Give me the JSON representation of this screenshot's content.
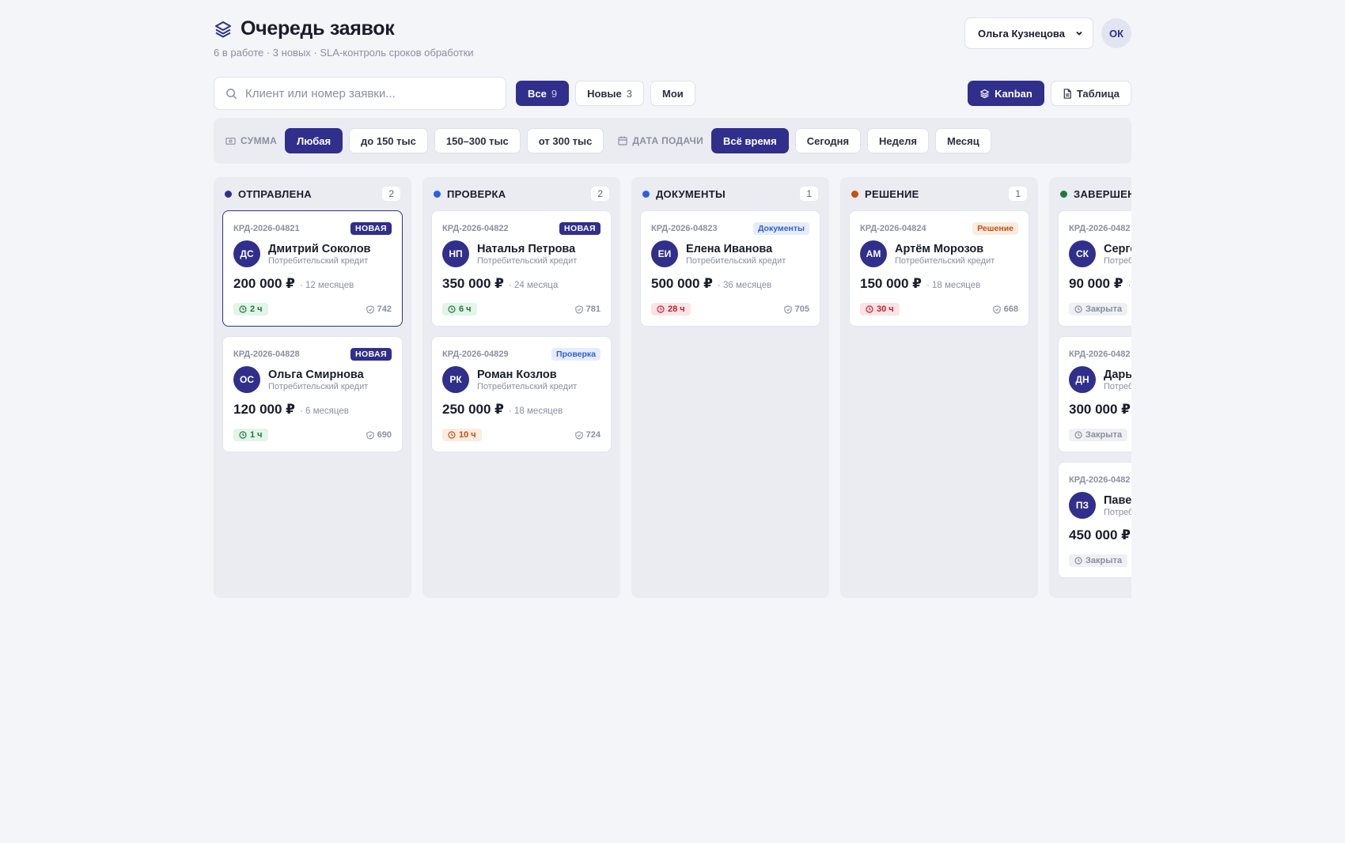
{
  "header": {
    "title": "Очередь заявок",
    "subtitle": "6 в работе · 3 новых · SLA-контроль сроков обработки",
    "user_select": "Ольга Кузнецова",
    "user_initials": "ОК"
  },
  "search": {
    "placeholder": "Клиент или номер заявки..."
  },
  "tabs": [
    {
      "label": "Все",
      "count": "9"
    },
    {
      "label": "Новые",
      "count": "3"
    },
    {
      "label": "Мои"
    }
  ],
  "views": {
    "kanban": "Kanban",
    "table": "Таблица"
  },
  "filters": {
    "sum_label": "СУММА",
    "sum_options": [
      "Любая",
      "до 150 тыс",
      "150–300 тыс",
      "от 300 тыс"
    ],
    "date_label": "ДАТА ПОДАЧИ",
    "date_options": [
      "Всё время",
      "Сегодня",
      "Неделя",
      "Месяц"
    ]
  },
  "colors": {
    "accent": "#302f8c",
    "sent": "#302f8c",
    "review": "#2f5fd8",
    "docs": "#2f5fd8",
    "decision": "#c2510f",
    "done": "#1f7a3f"
  },
  "columns": [
    {
      "title": "ОТПРАВЛЕНА",
      "count": "2",
      "cards": [
        {
          "id": "КРД-2026-04821",
          "badge": "НОВАЯ",
          "initials": "ДС",
          "name": "Дмитрий Соколов",
          "product": "Потребительский кредит",
          "amount": "200 000 ₽",
          "term": "· 12 месяцев",
          "sla": "2 ч",
          "score": "742"
        },
        {
          "id": "КРД-2026-04828",
          "badge": "НОВАЯ",
          "initials": "ОС",
          "name": "Ольга Смирнова",
          "product": "Потребительский кредит",
          "amount": "120 000 ₽",
          "term": "· 6 месяцев",
          "sla": "1 ч",
          "score": "690"
        }
      ]
    },
    {
      "title": "ПРОВЕРКА",
      "count": "2",
      "cards": [
        {
          "id": "КРД-2026-04822",
          "badge": "НОВАЯ",
          "initials": "НП",
          "name": "Наталья Петрова",
          "product": "Потребительский кредит",
          "amount": "350 000 ₽",
          "term": "· 24 месяца",
          "sla": "6 ч",
          "score": "781"
        },
        {
          "id": "КРД-2026-04829",
          "badge": "Проверка",
          "initials": "РК",
          "name": "Роман Козлов",
          "product": "Потребительский кредит",
          "amount": "250 000 ₽",
          "term": "· 18 месяцев",
          "sla": "10 ч",
          "score": "724"
        }
      ]
    },
    {
      "title": "ДОКУМЕНТЫ",
      "count": "1",
      "cards": [
        {
          "id": "КРД-2026-04823",
          "badge": "Документы",
          "initials": "ЕИ",
          "name": "Елена Иванова",
          "product": "Потребительский кредит",
          "amount": "500 000 ₽",
          "term": "· 36 месяцев",
          "sla": "28 ч",
          "score": "705"
        }
      ]
    },
    {
      "title": "РЕШЕНИЕ",
      "count": "1",
      "cards": [
        {
          "id": "КРД-2026-04824",
          "badge": "Решение",
          "initials": "АМ",
          "name": "Артём Морозов",
          "product": "Потребительский кредит",
          "amount": "150 000 ₽",
          "term": "· 18 месяцев",
          "sla": "30 ч",
          "score": "668"
        }
      ]
    },
    {
      "title": "ЗАВЕРШЕН",
      "cards": [
        {
          "id": "КРД-2026-0482",
          "initials": "СК",
          "name": "Серге",
          "product": "Потреб",
          "amount": "90 000 ₽",
          "term": "·",
          "sla": "Закрыта"
        },
        {
          "id": "КРД-2026-0482",
          "initials": "ДН",
          "name": "Дарь",
          "product": "Потреб",
          "amount": "300 000 ₽",
          "sla": "Закрыта"
        },
        {
          "id": "КРД-2026-0482",
          "initials": "ПЗ",
          "name": "Паве",
          "product": "Потреб",
          "amount": "450 000 ₽",
          "sla": "Закрыта"
        }
      ]
    }
  ]
}
